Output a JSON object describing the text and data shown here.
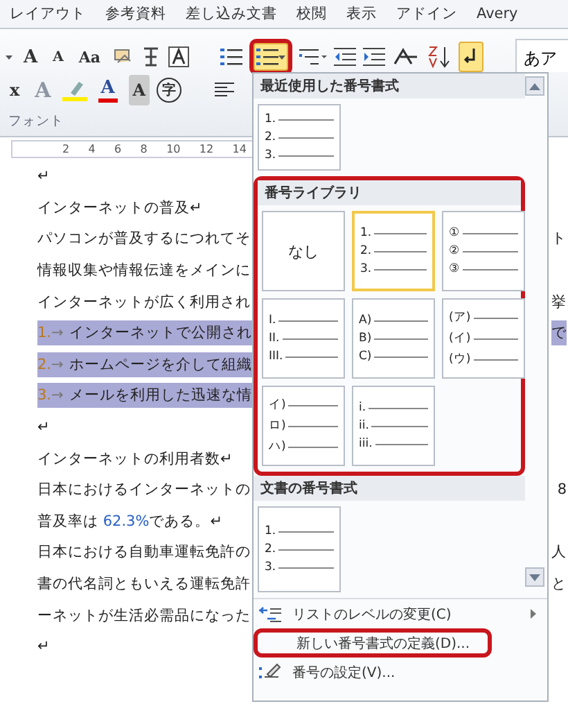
{
  "ribbon_tabs": [
    "レイアウト",
    "参考資料",
    "差し込み文書",
    "校閲",
    "表示",
    "アドイン",
    "Avery"
  ],
  "ribbon": {
    "grow_font": "A",
    "shrink_font": "A",
    "change_case": "Aa",
    "superscript": "x",
    "text_effect": "A",
    "font_color": "A",
    "char_shading": "A",
    "enclosed_char": "字",
    "style_preview": "あア",
    "group_label": "フォント",
    "numbering": {
      "active": true,
      "highlighted": true
    },
    "show_marks": {
      "active": true
    }
  },
  "ruler": [
    "2",
    "4",
    "6",
    "8",
    "10",
    "12",
    "14"
  ],
  "document": [
    {
      "text": "↵"
    },
    {
      "text": "インターネットの普及↵"
    },
    {
      "text": "パソコンが普及するにつれてそ",
      "tail": "ト"
    },
    {
      "text": "情報収集や情報伝達をメインに"
    },
    {
      "text": "インターネットが広く利用され",
      "tail": "挙"
    },
    {
      "number": "1.",
      "arrow": "→",
      "text": "インターネットで公開され",
      "highlighted": true,
      "tail": "で"
    },
    {
      "number": "2.",
      "arrow": "→",
      "text": "ホームページを介して組織",
      "highlighted": true
    },
    {
      "number": "3.",
      "arrow": "→",
      "text": "メールを利用した迅速な情",
      "highlighted": true
    },
    {
      "text": "↵"
    },
    {
      "text": "インターネットの利用者数↵"
    },
    {
      "text": "日本におけるインターネットの",
      "tail": "8"
    },
    {
      "segments": [
        {
          "text": "普及率は "
        },
        {
          "text": "62.3%",
          "kind": "figure"
        },
        {
          "text": "である。↵"
        }
      ]
    },
    {
      "text": "日本における自動車運転免許の",
      "tail": "人"
    },
    {
      "text": "書の代名詞ともいえる運転免許",
      "tail": "と"
    },
    {
      "text": "ーネットが生活必需品になった"
    },
    {
      "text": "↵"
    }
  ],
  "dropdown": {
    "sections": [
      {
        "title": "最近使用した番号書式",
        "highlighted": false,
        "tiles": [
          {
            "kind": "list",
            "labels": [
              "1.",
              "2.",
              "3."
            ],
            "selected": false
          }
        ]
      },
      {
        "title": "番号ライブラリ",
        "highlighted": true,
        "tiles": [
          {
            "kind": "none",
            "text": "なし",
            "selected": false
          },
          {
            "kind": "list",
            "labels": [
              "1.",
              "2.",
              "3."
            ],
            "selected": true
          },
          {
            "kind": "list",
            "labels": [
              "①",
              "②",
              "③"
            ],
            "selected": false
          },
          {
            "kind": "list",
            "labels": [
              "I.",
              "II.",
              "III."
            ],
            "selected": false
          },
          {
            "kind": "list",
            "labels": [
              "A)",
              "B)",
              "C)"
            ],
            "selected": false
          },
          {
            "kind": "list",
            "labels": [
              "(ア)",
              "(イ)",
              "(ウ)"
            ],
            "selected": false
          },
          {
            "kind": "list",
            "labels": [
              "イ)",
              "ロ)",
              "ハ)"
            ],
            "selected": false
          },
          {
            "kind": "list",
            "labels": [
              "i.",
              "ii.",
              "iii."
            ],
            "selected": false
          }
        ]
      },
      {
        "title": "文書の番号書式",
        "highlighted": false,
        "tiles": [
          {
            "kind": "list",
            "labels": [
              "1.",
              "2.",
              "3."
            ],
            "selected": false
          }
        ]
      }
    ],
    "menu": [
      {
        "kind": "level",
        "label": "リストのレベルの変更(C)",
        "submenu": true,
        "highlighted": false
      },
      {
        "kind": "plain",
        "label": "新しい番号書式の定義(D)...",
        "submenu": false,
        "highlighted": true
      },
      {
        "kind": "settings",
        "label": "番号の設定(V)...",
        "submenu": false,
        "highlighted": false
      }
    ]
  }
}
